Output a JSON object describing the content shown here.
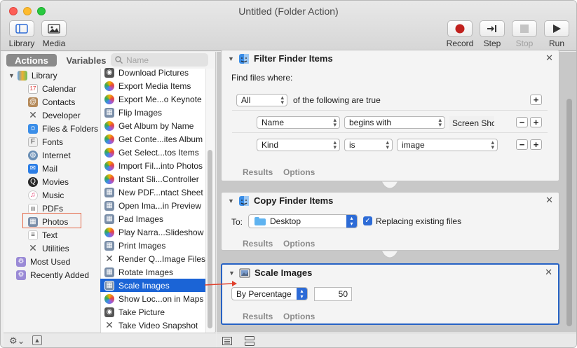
{
  "window": {
    "title": "Untitled (Folder Action)"
  },
  "toolbar": {
    "library": "Library",
    "media": "Media",
    "record": "Record",
    "step": "Step",
    "stop": "Stop",
    "run": "Run"
  },
  "left": {
    "tab_actions": "Actions",
    "tab_variables": "Variables",
    "search_placeholder": "Name",
    "library_items": [
      "Library",
      "Calendar",
      "Contacts",
      "Developer",
      "Files & Folders",
      "Fonts",
      "Internet",
      "Mail",
      "Movies",
      "Music",
      "PDFs",
      "Photos",
      "Text",
      "Utilities",
      "Most Used",
      "Recently Added"
    ],
    "actions": [
      "Download Pictures",
      "Export Media Items",
      "Export Me...o Keynote",
      "Flip Images",
      "Get Album by Name",
      "Get Conte...ites Album",
      "Get Select...tos Items",
      "Import Fil...into Photos",
      "Instant Sli...Controller",
      "New PDF...ntact Sheet",
      "Open Ima...in Preview",
      "Pad Images",
      "Play Narra...Slideshow",
      "Print Images",
      "Render Q...Image Files",
      "Rotate Images",
      "Scale Images",
      "Show Loc...on in Maps",
      "Take Picture",
      "Take Video Snapshot"
    ]
  },
  "filter": {
    "title": "Filter Finder Items",
    "find_label": "Find files where:",
    "quantifier": "All",
    "quantifier_suffix": "of the following are true",
    "rule1_field": "Name",
    "rule1_op": "begins with",
    "rule1_value": "Screen Shc",
    "rule2_field": "Kind",
    "rule2_op": "is",
    "rule2_value": "image",
    "results": "Results",
    "options": "Options"
  },
  "copy": {
    "title": "Copy Finder Items",
    "to_label": "To:",
    "destination": "Desktop",
    "replacing": "Replacing existing files",
    "results": "Results",
    "options": "Options"
  },
  "scale": {
    "title": "Scale Images",
    "mode": "By Percentage",
    "value": "50",
    "results": "Results",
    "options": "Options"
  },
  "colors": {
    "selection": "#1b64d6",
    "highlight_box": "#e46a4a",
    "card_selected": "#2762c4",
    "record_red": "#c0201d"
  }
}
